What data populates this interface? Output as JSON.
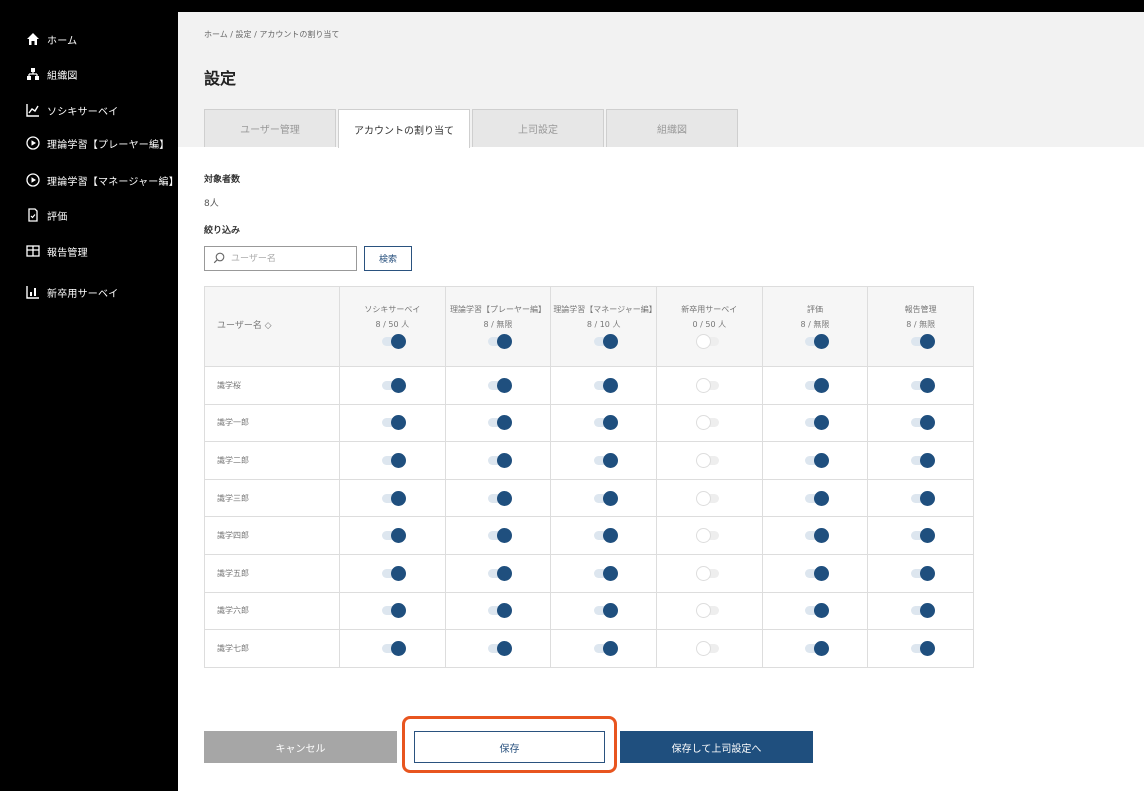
{
  "sidebar": {
    "items": [
      {
        "label": "ホーム",
        "icon": "home-icon"
      },
      {
        "label": "組織図",
        "icon": "org-chart-icon"
      },
      {
        "label": "ソシキサーベイ",
        "icon": "chart-icon"
      },
      {
        "label": "理論学習【プレーヤー編】",
        "icon": "play-icon"
      },
      {
        "label": "理論学習【マネージャー編】",
        "icon": "play-icon"
      },
      {
        "label": "評価",
        "icon": "document-icon"
      },
      {
        "label": "報告管理",
        "icon": "grid-icon"
      },
      {
        "label": "新卒用サーベイ",
        "icon": "survey-icon"
      }
    ]
  },
  "header": {
    "breadcrumb": "ホーム / 設定 / アカウントの割り当て",
    "title": "設定"
  },
  "tabs": [
    {
      "label": "ユーザー管理",
      "active": false
    },
    {
      "label": "アカウントの割り当て",
      "active": true
    },
    {
      "label": "上司設定",
      "active": false
    },
    {
      "label": "組織図",
      "active": false
    }
  ],
  "summary": {
    "target_label": "対象者数",
    "target_value": "8人",
    "filter_label": "絞り込み"
  },
  "search": {
    "placeholder": "ユーザー名",
    "button_label": "検索"
  },
  "table": {
    "user_col_label": "ユーザー名 ◇",
    "columns": [
      {
        "label": "ソシキサーベイ",
        "count": "8 / 50 人",
        "all_on": true
      },
      {
        "label": "理論学習【プレーヤー編】",
        "count": "8 / 無限",
        "all_on": true
      },
      {
        "label": "理論学習【マネージャー編】",
        "count": "8 / 10 人",
        "all_on": true
      },
      {
        "label": "新卒用サーベイ",
        "count": "0 / 50 人",
        "all_on": false
      },
      {
        "label": "評価",
        "count": "8 / 無限",
        "all_on": true
      },
      {
        "label": "報告管理",
        "count": "8 / 無限",
        "all_on": true
      }
    ],
    "rows": [
      {
        "name": "識学桜",
        "toggles": [
          true,
          true,
          true,
          false,
          true,
          true
        ]
      },
      {
        "name": "識学一郎",
        "toggles": [
          true,
          true,
          true,
          false,
          true,
          true
        ]
      },
      {
        "name": "識学二郎",
        "toggles": [
          true,
          true,
          true,
          false,
          true,
          true
        ]
      },
      {
        "name": "識学三郎",
        "toggles": [
          true,
          true,
          true,
          false,
          true,
          true
        ]
      },
      {
        "name": "識学四郎",
        "toggles": [
          true,
          true,
          true,
          false,
          true,
          true
        ]
      },
      {
        "name": "識学五郎",
        "toggles": [
          true,
          true,
          true,
          false,
          true,
          true
        ]
      },
      {
        "name": "識学六郎",
        "toggles": [
          true,
          true,
          true,
          false,
          true,
          true
        ]
      },
      {
        "name": "識学七郎",
        "toggles": [
          true,
          true,
          true,
          false,
          true,
          true
        ]
      }
    ]
  },
  "buttons": {
    "cancel": "キャンセル",
    "save": "保存",
    "save_next": "保存して上司設定へ"
  },
  "colors": {
    "accent": "#1f4f7e",
    "highlight": "#e8551f",
    "sidebar_bg": "#000000"
  }
}
